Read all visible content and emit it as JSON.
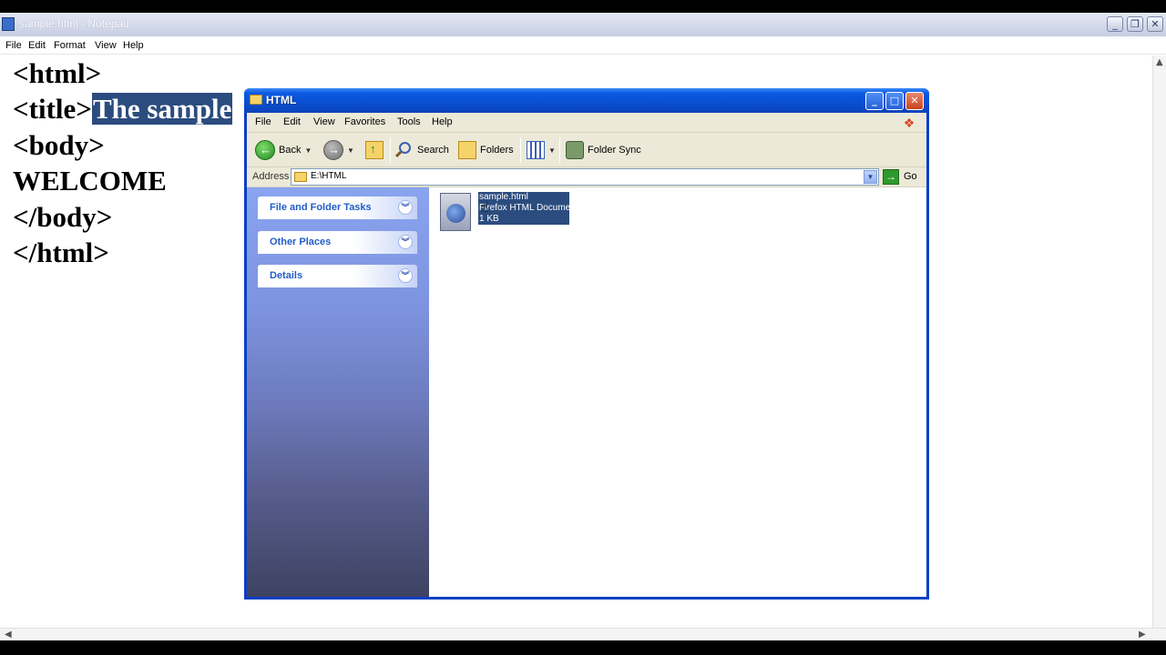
{
  "notepad": {
    "title": "sample.html - Notepad",
    "menu": [
      "File",
      "Edit",
      "Format",
      "View",
      "Help"
    ],
    "lines": {
      "l1": "<html>",
      "l2_tag": "<title>",
      "l2_sel": "The sample",
      "l3": "<body>",
      "l4": "WELCOME",
      "l5": "</body>",
      "l6": "</html>"
    }
  },
  "explorer": {
    "title": "HTML",
    "menu": [
      "File",
      "Edit",
      "View",
      "Favorites",
      "Tools",
      "Help"
    ],
    "toolbar": {
      "back": "Back",
      "search": "Search",
      "folders": "Folders",
      "folder_sync": "Folder Sync"
    },
    "address": {
      "label": "Address",
      "value": "E:\\HTML",
      "go": "Go"
    },
    "tasks": [
      {
        "label": "File and Folder Tasks"
      },
      {
        "label": "Other Places"
      },
      {
        "label": "Details"
      }
    ],
    "file": {
      "name": "sample.html",
      "type": "Firefox HTML Document",
      "size": "1 KB"
    }
  },
  "colors": {
    "title_blue": "#0b59e2",
    "selection": "#2b4c7e",
    "task_link": "#215dc6"
  }
}
